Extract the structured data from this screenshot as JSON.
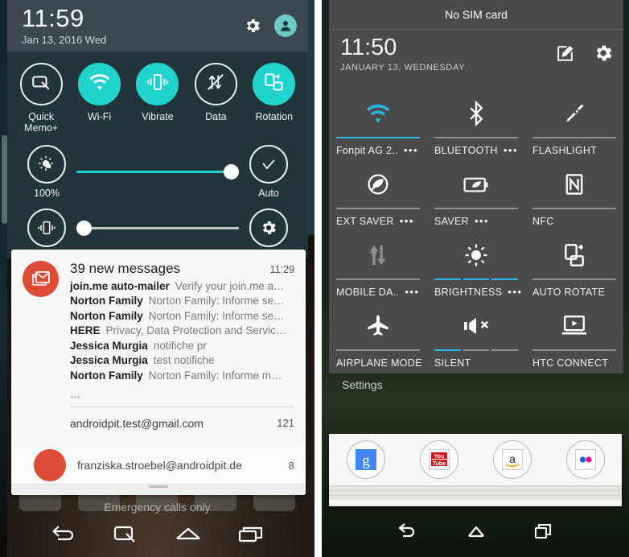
{
  "left_phone": {
    "status": {
      "clock": "11:59",
      "date": "Jan 13, 2016 Wed",
      "gear_icon": "gear-icon",
      "avatar_icon": "user-avatar-icon"
    },
    "toggles": [
      {
        "label": "Quick Memo+",
        "icon": "quick-memo-icon",
        "state": "off"
      },
      {
        "label": "Wi-Fi",
        "icon": "wifi-icon",
        "state": "on"
      },
      {
        "label": "Vibrate",
        "icon": "vibrate-icon",
        "state": "on"
      },
      {
        "label": "Data",
        "icon": "mobile-data-off-icon",
        "state": "off"
      },
      {
        "label": "Rotation",
        "icon": "rotation-icon",
        "state": "on"
      }
    ],
    "brightness": {
      "icon": "brightness-icon",
      "value_label": "100%",
      "percent": 100,
      "auto_label": "Auto",
      "auto_icon": "check-icon",
      "track_color": "#20d3cd"
    },
    "volume": {
      "icon": "vibrate-ring-icon",
      "percent": 5,
      "settings_icon": "gear-icon",
      "track_color": "#c8c8c8"
    },
    "notification": {
      "app_icon": "gmail-icon",
      "title": "39 new messages",
      "time": "11:29",
      "messages": [
        {
          "sender": "join.me auto-mailer",
          "subject": "Verify your join.me a…"
        },
        {
          "sender": "Norton Family",
          "subject": "Norton Family: Informe se…"
        },
        {
          "sender": "Norton Family",
          "subject": "Norton Family: Informe se…"
        },
        {
          "sender": "HERE",
          "subject": "Privacy, Data Protection and Servic…"
        },
        {
          "sender": "Jessica Murgia",
          "subject": "notifiche pr"
        },
        {
          "sender": "Jessica Murgia",
          "subject": "test notifiche"
        },
        {
          "sender": "Norton Family",
          "subject": "Norton Family: Informe m…"
        }
      ],
      "more_indicator": "…",
      "account": "androidpit.test@gmail.com",
      "count": "121",
      "second_account": "franziska.stroebel@androidpit.de",
      "second_count": "8"
    },
    "emergency_text": "Emergency calls only",
    "navbar": [
      {
        "name": "back-button",
        "icon": "back-icon"
      },
      {
        "name": "quick-memo-button",
        "icon": "quick-memo-icon"
      },
      {
        "name": "home-button",
        "icon": "home-icon"
      },
      {
        "name": "recents-button",
        "icon": "recents-icon"
      }
    ]
  },
  "right_phone": {
    "sim_status": "No SIM card",
    "status": {
      "clock": "11:50",
      "date": "JANUARY 13, WEDNESDAY",
      "edit_icon": "edit-icon",
      "settings_icon": "gear-icon"
    },
    "tiles": [
      {
        "label": "Fonpit AG 2..",
        "icon": "wifi-icon",
        "state": "on",
        "has_dots": true,
        "underline": "active"
      },
      {
        "label": "BLUETOOTH",
        "icon": "bluetooth-icon",
        "state": "off",
        "has_dots": true,
        "underline": "inactive"
      },
      {
        "label": "FLASHLIGHT",
        "icon": "flashlight-icon",
        "state": "off",
        "has_dots": false,
        "underline": "inactive"
      },
      {
        "label": "EXT SAVER",
        "icon": "extreme-power-saver-icon",
        "state": "off",
        "has_dots": true,
        "underline": "inactive"
      },
      {
        "label": "SAVER",
        "icon": "power-saver-icon",
        "state": "off",
        "has_dots": true,
        "underline": "inactive"
      },
      {
        "label": "NFC",
        "icon": "nfc-icon",
        "state": "off",
        "has_dots": false,
        "underline": "inactive"
      },
      {
        "label": "MOBILE DA..",
        "icon": "mobile-data-icon",
        "state": "off",
        "has_dots": true,
        "underline": "inactive"
      },
      {
        "label": "BRIGHTNESS",
        "icon": "brightness-icon",
        "state": "on",
        "has_dots": true,
        "underline": "segments-3"
      },
      {
        "label": "AUTO ROTATE",
        "icon": "auto-rotate-icon",
        "state": "off",
        "has_dots": false,
        "underline": "inactive"
      },
      {
        "label": "AIRPLANE MODE",
        "icon": "airplane-icon",
        "state": "off",
        "has_dots": false,
        "underline": "inactive"
      },
      {
        "label": "SILENT",
        "icon": "mute-icon",
        "state": "on",
        "has_dots": false,
        "underline": "segments-1"
      },
      {
        "label": "HTC CONNECT",
        "icon": "htc-connect-icon",
        "state": "off",
        "has_dots": false,
        "underline": "inactive"
      }
    ],
    "dots_glyph": "•••",
    "settings_label": "Settings",
    "quick_launch": [
      {
        "label": "Google",
        "icon": "google-icon"
      },
      {
        "label": "YouTube",
        "icon": "youtube-icon"
      },
      {
        "label": "Amazon",
        "icon": "amazon-icon"
      },
      {
        "label": "Flickr",
        "icon": "flickr-icon"
      }
    ],
    "navbar": [
      {
        "name": "back-button",
        "icon": "back-icon"
      },
      {
        "name": "home-button",
        "icon": "home-icon"
      },
      {
        "name": "recents-button",
        "icon": "recents-icon"
      }
    ]
  },
  "colors": {
    "lg_accent": "#20d3cd",
    "lg_header_bg": "#3b4a50",
    "lg_panel_bg": "#22353a",
    "htc_panel_bg": "#4b4b4b",
    "htc_accent": "#29b6e8",
    "gmail_red": "#dd4b39"
  }
}
